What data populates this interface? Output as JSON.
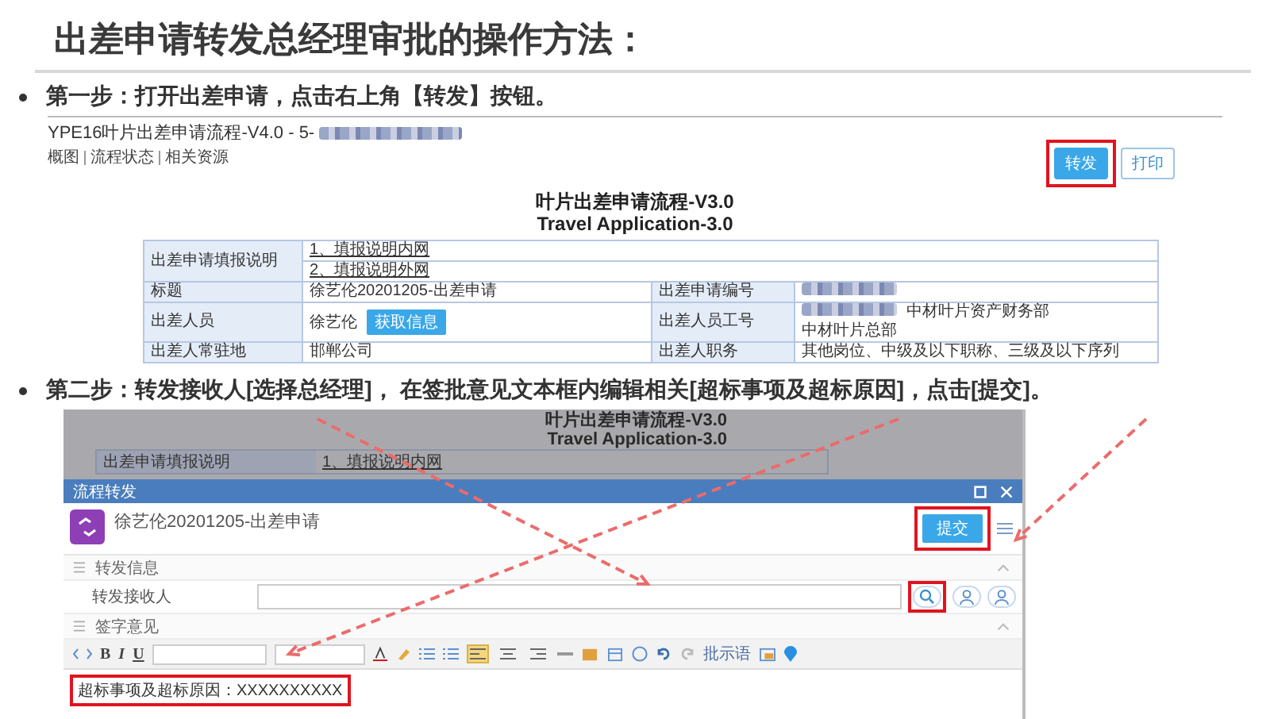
{
  "title": "出差申请转发总经理审批的操作方法：",
  "step1": {
    "text": "第一步：打开出差申请，点击右上角【转发】按钮。",
    "screen": {
      "header_title": "YPE16叶片出差申请流程-V4.0 - 5-",
      "links": [
        "概图",
        "流程状态",
        "相关资源"
      ],
      "buttons": [
        {
          "label": "转发",
          "kind": "primary",
          "highlighted": true
        },
        {
          "label": "打印",
          "kind": "plain",
          "highlighted": false
        }
      ],
      "form_title": "叶片出差申请流程-V3.0",
      "form_subtitle": "Travel Application-3.0",
      "intro_row": {
        "label": "出差申请填报说明",
        "links": [
          "1、填报说明内网",
          "2、填报说明外网"
        ]
      },
      "rows": [
        {
          "label": "标题",
          "value": [
            {
              "kind": "text",
              "text": "徐艺伦20201205-出差申请"
            }
          ],
          "label_2": "出差申请编号",
          "value_2": [
            {
              "kind": "redacted"
            }
          ]
        },
        {
          "label": "出差人员",
          "value": [
            {
              "kind": "text",
              "text": "徐艺伦"
            },
            {
              "kind": "button",
              "text": "获取信息"
            }
          ],
          "label_2": "出差人员工号",
          "value_2": [
            {
              "kind": "redacted"
            },
            {
              "kind": "text",
              "text": "中材叶片资产财务部"
            },
            {
              "kind": "text",
              "text": "中材叶片总部"
            }
          ]
        },
        {
          "label": "出差人常驻地",
          "value": [
            {
              "kind": "text",
              "text": "邯郸公司"
            }
          ],
          "label_2": "出差人职务",
          "value_2": [
            {
              "kind": "text",
              "text": "其他岗位、中级及以下职称、三级及以下序列"
            }
          ]
        }
      ]
    }
  },
  "step2": {
    "text": "第二步：转发接收人[选择总经理]， 在签批意见文本框内编辑相关[超标事项及超标原因]，点击[提交]。",
    "screen": {
      "form_title": "叶片出差申请流程-V3.0",
      "form_subtitle": "Travel Application-3.0",
      "row_label": "出差申请填报说明",
      "row_link": "1、填报说明内网",
      "dialog": {
        "title": "流程转发",
        "subject": "徐艺伦20201205-出差申请",
        "submit": {
          "label": "提交",
          "highlighted": true
        },
        "sections": [
          {
            "title": "转发信息",
            "expanded": true
          },
          {
            "title": "签字意见",
            "expanded": true
          }
        ],
        "recipient": {
          "label": "转发接收人",
          "search_highlighted": true
        },
        "toolbar": {
          "letters": [
            "B",
            "I",
            "U"
          ],
          "aligns": [
            {
              "selected": true
            },
            {
              "selected": false
            },
            {
              "selected": false
            }
          ],
          "phrase_button": "批示语"
        },
        "editor": {
          "text": "超标事项及超标原因：XXXXXXXXXX",
          "highlighted": true
        }
      }
    }
  }
}
